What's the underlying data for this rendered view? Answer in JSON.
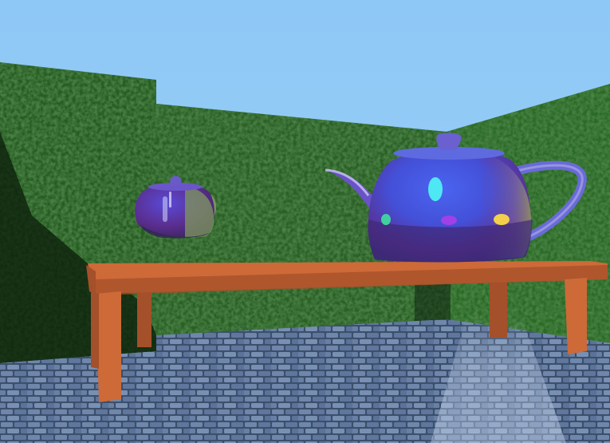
{
  "scene": {
    "kind": "3d-rendered-scene",
    "objects": [
      "sky",
      "hedge-wall-left",
      "hedge-wall-back",
      "hedge-wall-right",
      "cobblestone-floor",
      "wooden-table",
      "teapot-large",
      "teapot-small"
    ]
  },
  "colors": {
    "sky": "#8ec8f6",
    "hedge_light": "#2f6a2a",
    "hedge_dark": "#142f12",
    "floor": "#5d7599",
    "floor_grout": "#3c4f6c",
    "table": "#cd6a38",
    "table_dark": "#a4502a",
    "teapot_blue": "#4450d8",
    "teapot_purple": "#5a2e8e",
    "teapot_green": "#7fa05e",
    "highlight_cyan": "#4ee8f5",
    "highlight_yellow": "#f3d04c"
  }
}
